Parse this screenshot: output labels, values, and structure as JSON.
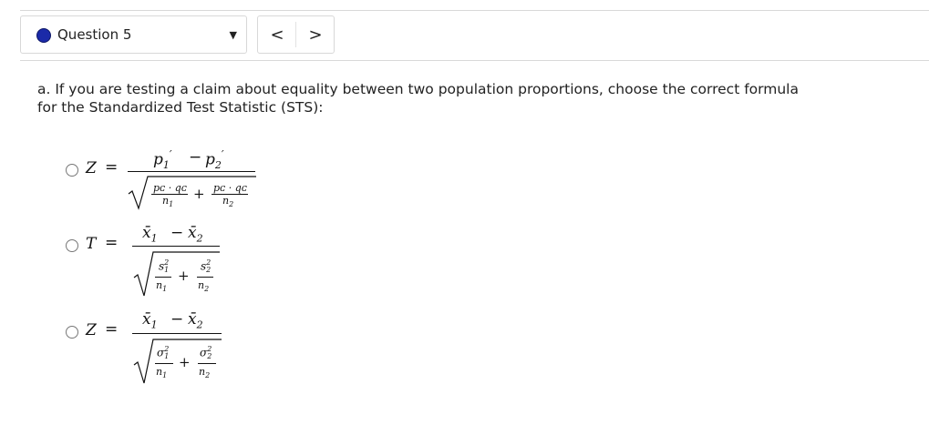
{
  "question_nav": {
    "current_label": "Question 5",
    "status_color": "#1b2aa8",
    "dropdown_icon": "caret-down-icon",
    "prev_icon": "chevron-left-icon",
    "next_icon": "chevron-right-icon",
    "prev_glyph": "<",
    "next_glyph": ">"
  },
  "prompt": {
    "text": "a. If you are testing a claim about equality between two population proportions, choose the correct formula for the Standardized Test Statistic (STS):"
  },
  "options": [
    {
      "lhs": "Z",
      "formula_latex": "Z = \\frac{p_1' - p_2'}{\\sqrt{\\frac{p_c \\cdot q_c}{n_1} + \\frac{p_c \\cdot q_c}{n_2}}}",
      "numerator": {
        "a": "p",
        "a_sub": "1",
        "b": "p",
        "b_sub": "2",
        "prime": "′",
        "minus": "−"
      },
      "terms": [
        {
          "num": "pᴄ · qᴄ",
          "den": "n",
          "den_sub": "1"
        },
        {
          "num": "pᴄ · qᴄ",
          "den": "n",
          "den_sub": "2"
        }
      ],
      "plus": "+"
    },
    {
      "lhs": "T",
      "formula_latex": "T = \\frac{\\bar{x}_1 - \\bar{x}_2}{\\sqrt{\\frac{s_1^2}{n_1} + \\frac{s_2^2}{n_2}}}",
      "numerator": {
        "a": "x̄",
        "a_sub": "1",
        "b": "x̄",
        "b_sub": "2",
        "minus": "−"
      },
      "terms": [
        {
          "num": "s",
          "num_sub": "1",
          "num_sup": "2",
          "den": "n",
          "den_sub": "1"
        },
        {
          "num": "s",
          "num_sub": "2",
          "num_sup": "2",
          "den": "n",
          "den_sub": "2"
        }
      ],
      "plus": "+"
    },
    {
      "lhs": "Z",
      "formula_latex": "Z = \\frac{\\bar{x}_1 - \\bar{x}_2}{\\sqrt{\\frac{\\sigma_1^2}{n_1} + \\frac{\\sigma_2^2}{n_2}}}",
      "numerator": {
        "a": "x̄",
        "a_sub": "1",
        "b": "x̄",
        "b_sub": "2",
        "minus": "−"
      },
      "terms": [
        {
          "num": "σ",
          "num_sub": "1",
          "num_sup": "2",
          "den": "n",
          "den_sub": "1"
        },
        {
          "num": "σ",
          "num_sub": "2",
          "num_sup": "2",
          "den": "n",
          "den_sub": "2"
        }
      ],
      "plus": "+"
    }
  ],
  "equals": "="
}
